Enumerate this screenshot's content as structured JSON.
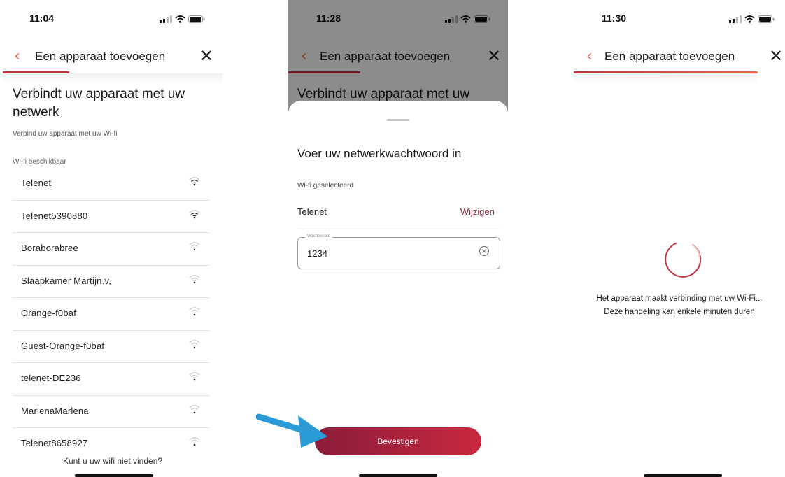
{
  "screen1": {
    "time": "11:04",
    "nav_title": "Een apparaat toevoegen",
    "heading_line1": "Verbindt uw apparaat met uw",
    "heading_line2": "netwerk",
    "subheading": "Verbind uw apparaat met uw Wi-fi",
    "section_label": "Wi-fi beschikbaar",
    "networks": [
      {
        "name": "Telenet",
        "signal": "strong"
      },
      {
        "name": "Telenet5390880",
        "signal": "strong"
      },
      {
        "name": "Boraborabree",
        "signal": "weak"
      },
      {
        "name": "Slaapkamer Martijn.v,",
        "signal": "weak"
      },
      {
        "name": "Orange-f0baf",
        "signal": "weak"
      },
      {
        "name": "Guest-Orange-f0baf",
        "signal": "weak"
      },
      {
        "name": "telenet-DE236",
        "signal": "weak"
      },
      {
        "name": "MarlenaMarlena",
        "signal": "weak"
      },
      {
        "name": "Telenet8658927",
        "signal": "weak"
      }
    ],
    "footer_link": "Kunt u uw wifi niet vinden?"
  },
  "screen2": {
    "time": "11:28",
    "nav_title": "Een apparaat toevoegen",
    "background_heading": "Verbindt uw apparaat met uw",
    "sheet_title": "Voer uw netwerkwachtwoord in",
    "selected_label": "Wi-fi geselecteerd",
    "selected_network": "Telenet",
    "change_link": "Wijzigen",
    "password_label": "Wachtwoord",
    "password_value": "1234",
    "confirm_button": "Bevestigen"
  },
  "screen3": {
    "time": "11:30",
    "nav_title": "Een apparaat toevoegen",
    "message_line1": "Het apparaat maakt verbinding met uw Wi-Fi...",
    "message_line2": "Deze handeling kan enkele minuten duren"
  },
  "colors": {
    "accent": "#c2323e",
    "back_arrow": "#e8684f",
    "button_start": "#8a1c3a",
    "button_end": "#c9283f",
    "annotation_arrow": "#2b9bd6"
  },
  "icons": {
    "back": "chevron-left-icon",
    "close": "close-icon",
    "wifi": "wifi-icon",
    "clear": "clear-circle-icon",
    "spinner": "loading-spinner"
  }
}
